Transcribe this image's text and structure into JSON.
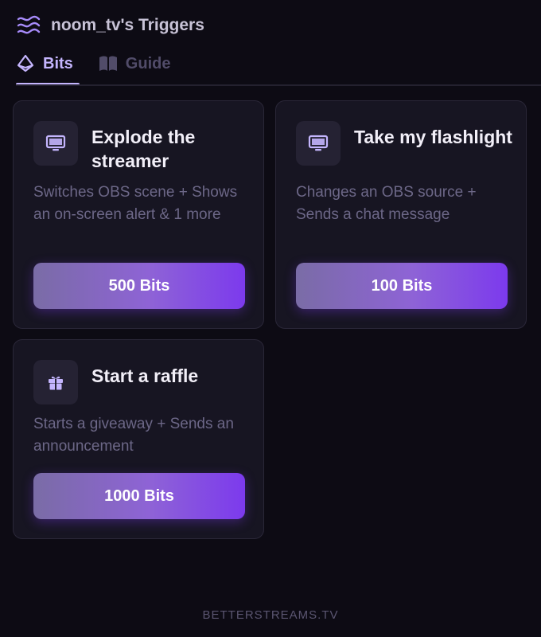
{
  "header": {
    "logo_icon": "waves-icon",
    "title": "noom_tv's Triggers"
  },
  "tabs": [
    {
      "label": "Bits",
      "icon": "bits-diamond-icon",
      "active": true
    },
    {
      "label": "Guide",
      "icon": "book-icon",
      "active": false
    }
  ],
  "triggers": [
    {
      "icon": "monitor-icon",
      "title": "Explode the streamer",
      "description": "Switches OBS scene + Shows an on-screen alert & 1 more",
      "cost_label": "500 Bits"
    },
    {
      "icon": "monitor-icon",
      "title": "Take my flashlight",
      "description": "Changes an OBS source + Sends a chat message",
      "cost_label": "100 Bits"
    },
    {
      "icon": "gift-icon",
      "title": "Start a raffle",
      "description": "Starts a giveaway + Sends an announcement",
      "cost_label": "1000 Bits"
    }
  ],
  "footer": {
    "brand": "BETTERSTREAMS.TV"
  },
  "colors": {
    "background": "#0d0b14",
    "card": "#171522",
    "accent": "#c4b5fd",
    "button_gradient_end": "#7c3aed"
  }
}
